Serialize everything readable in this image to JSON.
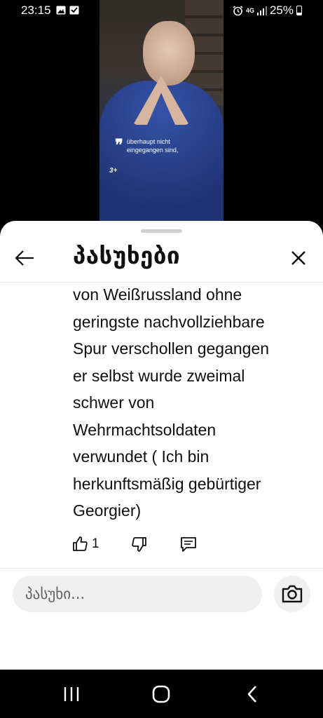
{
  "status_bar": {
    "time": "23:15",
    "network": "4G",
    "battery": "25%"
  },
  "video": {
    "subtitle": "überhaupt nicht\neingegangen sind,",
    "logo": "3+"
  },
  "sheet": {
    "title": "პასუხები",
    "comment_lines": [
      "von Weißrussland ohne",
      "geringste nachvollziehbare",
      "Spur verschollen gegangen",
      "er selbst wurde zweimal",
      "schwer von",
      "Wehrmachtsoldaten",
      "verwundet ( Ich bin",
      "herkunftsmäßig gebürtiger",
      "Georgier)"
    ],
    "like_count": "1",
    "reply_placeholder": "პასუხი..."
  }
}
